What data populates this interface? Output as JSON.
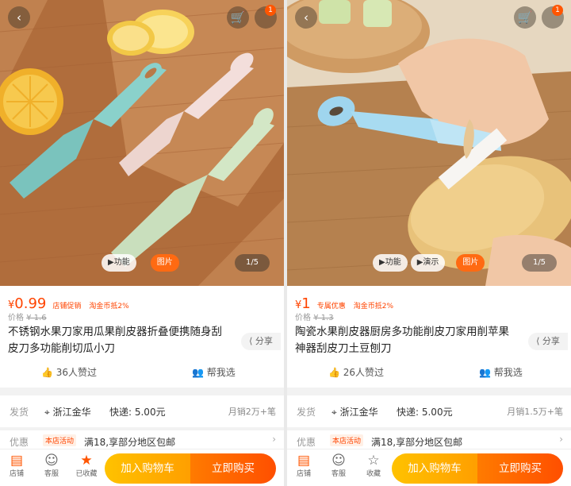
{
  "panels": [
    {
      "cart_badge": "1",
      "media_tabs": [
        "▶功能",
        "图片"
      ],
      "image_counter": "1/5",
      "price_symbol": "¥",
      "price": "0.99",
      "promo_tags": [
        "店铺促销",
        "淘金币抵2%"
      ],
      "original_price_label": "价格",
      "original_price": "¥ 1.6",
      "title_lines": [
        "不锈钢水果刀家用瓜果削皮器折叠便携随身刮",
        "皮刀多功能削切瓜小刀"
      ],
      "share_label": "分享",
      "likes": "36人赞过",
      "help_choose": "帮我选",
      "ship_label": "发货",
      "ship_location": "浙江金华",
      "ship_fee": "快递: 5.00元",
      "monthly_sales": "月销2万+笔",
      "discount_label": "优惠",
      "discount_tag": "本店活动",
      "discount_text": "满18,享部分地区包邮",
      "bar_icons": [
        "店铺",
        "客服",
        "已收藏"
      ],
      "add_to_cart": "加入购物车",
      "buy_now": "立即购买"
    },
    {
      "cart_badge": "1",
      "media_tabs": [
        "▶功能",
        "▶演示",
        "图片"
      ],
      "image_counter": "1/5",
      "price_symbol": "¥",
      "price": "1",
      "promo_tags": [
        "专属优惠",
        "淘金币抵2%"
      ],
      "original_price_label": "价格",
      "original_price": "¥ 1.3",
      "title_lines": [
        "陶瓷水果削皮器厨房多功能削皮刀家用削苹果",
        "神器刮皮刀土豆刨刀"
      ],
      "share_label": "分享",
      "likes": "26人赞过",
      "help_choose": "帮我选",
      "ship_label": "发货",
      "ship_location": "浙江金华",
      "ship_fee": "快递: 5.00元",
      "monthly_sales": "月销1.5万+笔",
      "discount_label": "优惠",
      "discount_tag": "本店活动",
      "discount_text": "满18,享部分地区包邮",
      "bar_icons": [
        "店铺",
        "客服",
        "收藏"
      ],
      "add_to_cart": "加入购物车",
      "buy_now": "立即购买"
    }
  ],
  "icons": {
    "back": "chevron-left-icon",
    "cart": "cart-icon",
    "share": "share-icon",
    "like": "thumbs-up-icon",
    "help": "people-icon",
    "location": "location-pin-icon",
    "shop": "shop-icon",
    "service": "chat-face-icon",
    "favorite_left": "star-filled-icon",
    "favorite_right": "star-outline-icon"
  },
  "colors": {
    "price": "#ff4400",
    "add_to_cart": "#ffb000",
    "buy_now": "#ff5a00",
    "badge": "#ff5500"
  }
}
